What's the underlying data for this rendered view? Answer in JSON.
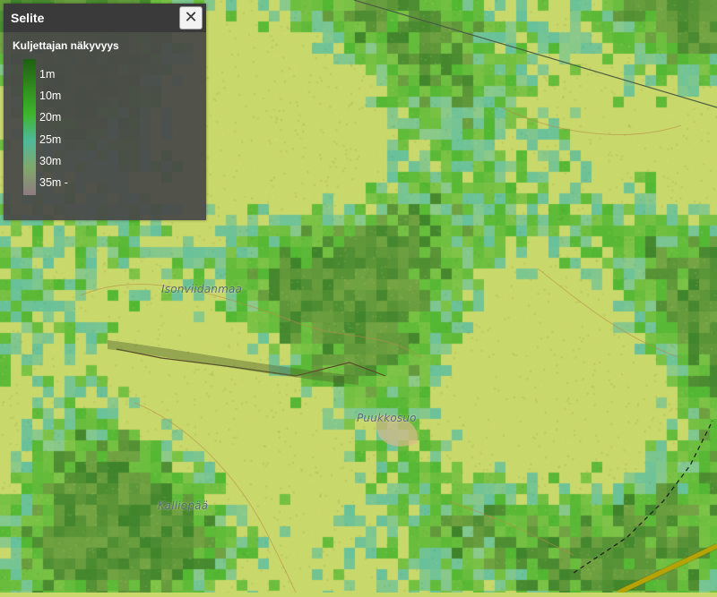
{
  "legend": {
    "title": "Selite",
    "close_label": "✕",
    "subtitle": "Kuljettajan näkyvyys",
    "ticks": [
      "1m",
      "10m",
      "20m",
      "25m",
      "30m",
      "35m -"
    ],
    "colors": [
      "#1e5f12",
      "#2f8a1e",
      "#3eb42c",
      "#4fb99a",
      "#7fa86a",
      "#907a80"
    ]
  },
  "map": {
    "place_names": [
      "Isonviidanmaa",
      "Puukkosuo",
      "Kalliopää"
    ],
    "colors": {
      "base": "#c9d86a",
      "green_dark": "#2f7a24",
      "green": "#44b32c",
      "teal": "#5cbea0",
      "swamp": "#d7b98a"
    }
  }
}
